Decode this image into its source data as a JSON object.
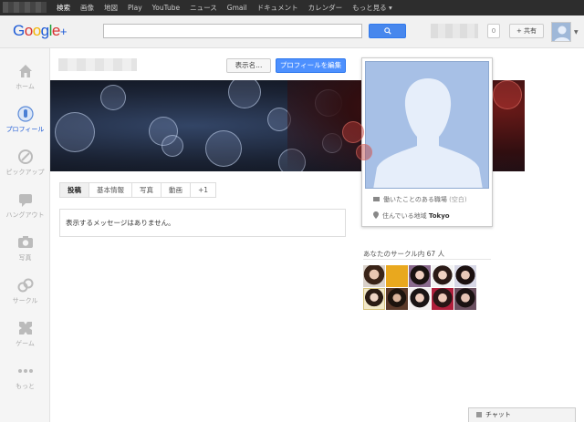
{
  "topbar": {
    "nav": [
      "検索",
      "画像",
      "地図",
      "Play",
      "YouTube",
      "ニュース",
      "Gmail",
      "ドキュメント",
      "カレンダー",
      "もっと見る ▾"
    ]
  },
  "header": {
    "logo": "Google+",
    "search_placeholder": "",
    "notification_count": "0",
    "share_label": "+ 共有"
  },
  "leftnav": [
    {
      "label": "ホーム",
      "icon": "home-icon",
      "active": false
    },
    {
      "label": "プロフィール",
      "icon": "profile-icon",
      "active": true
    },
    {
      "label": "ピックアップ",
      "icon": "compass-icon",
      "active": false
    },
    {
      "label": "ハングアウト",
      "icon": "hangout-icon",
      "active": false
    },
    {
      "label": "写真",
      "icon": "camera-icon",
      "active": false
    },
    {
      "label": "サークル",
      "icon": "circles-icon",
      "active": false
    },
    {
      "label": "ゲーム",
      "icon": "games-icon",
      "active": false
    },
    {
      "label": "もっと",
      "icon": "more-icon",
      "active": false
    }
  ],
  "profile": {
    "display_name_button": "表示名...",
    "edit_button": "プロフィールを編集",
    "tabs": [
      "投稿",
      "基本情報",
      "写真",
      "動画",
      "+1"
    ],
    "active_tab": 0,
    "empty_message": "表示するメッセージはありません。",
    "work_label": "働いたことのある職場",
    "work_value": "(空白)",
    "location_label": "住んでいる地域",
    "location_value": "Tokyo",
    "circles_title": "あなたのサークル内 67 人"
  },
  "chat": {
    "label": "チャット"
  },
  "colors": {
    "accent_blue": "#4d90fe",
    "active_nav": "#1e5bd6",
    "topbar": "#2d2d2d"
  }
}
